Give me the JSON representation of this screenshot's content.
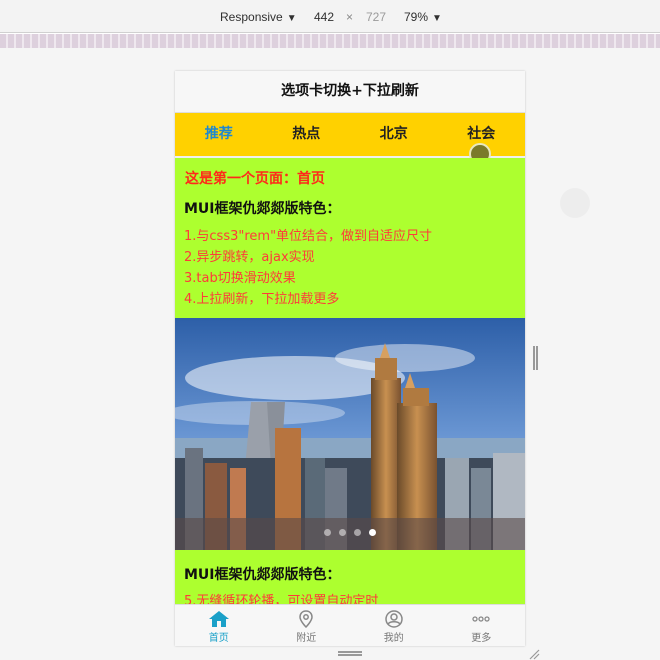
{
  "devtools": {
    "device": "Responsive",
    "width": "442",
    "times": "×",
    "height": "727",
    "zoom": "79%"
  },
  "header": {
    "title": "选项卡切换+下拉刷新"
  },
  "tabs": [
    {
      "label": "推荐",
      "active": true
    },
    {
      "label": "热点",
      "active": false
    },
    {
      "label": "北京",
      "active": false
    },
    {
      "label": "社会",
      "active": false
    }
  ],
  "content": {
    "page_title": "这是第一个页面：首页",
    "section1": {
      "heading": "MUI框架仇郯郯版特色：",
      "features": [
        "1.与css3\"rem\"单位结合，做到自适应尺寸",
        "2.异步跳转，ajax实现",
        "3.tab切换滑动效果",
        "4.上拉刷新，下拉加载更多"
      ]
    },
    "slider": {
      "slides": 4,
      "active_index": 3
    },
    "section2": {
      "heading": "MUI框架仇郯郯版特色：",
      "features": [
        "5.无缝循环轮播，可设置自动定时"
      ]
    }
  },
  "tabbar": [
    {
      "label": "首页",
      "icon": "home-icon",
      "active": true
    },
    {
      "label": "附近",
      "icon": "location-icon",
      "active": false
    },
    {
      "label": "我的",
      "icon": "user-icon",
      "active": false
    },
    {
      "label": "更多",
      "icon": "more-icon",
      "active": false
    }
  ],
  "colors": {
    "tab_bg": "#ffd100",
    "content_bg": "#adff2f",
    "accent": "#1e88d0",
    "feature_text": "#ff3a3a"
  }
}
